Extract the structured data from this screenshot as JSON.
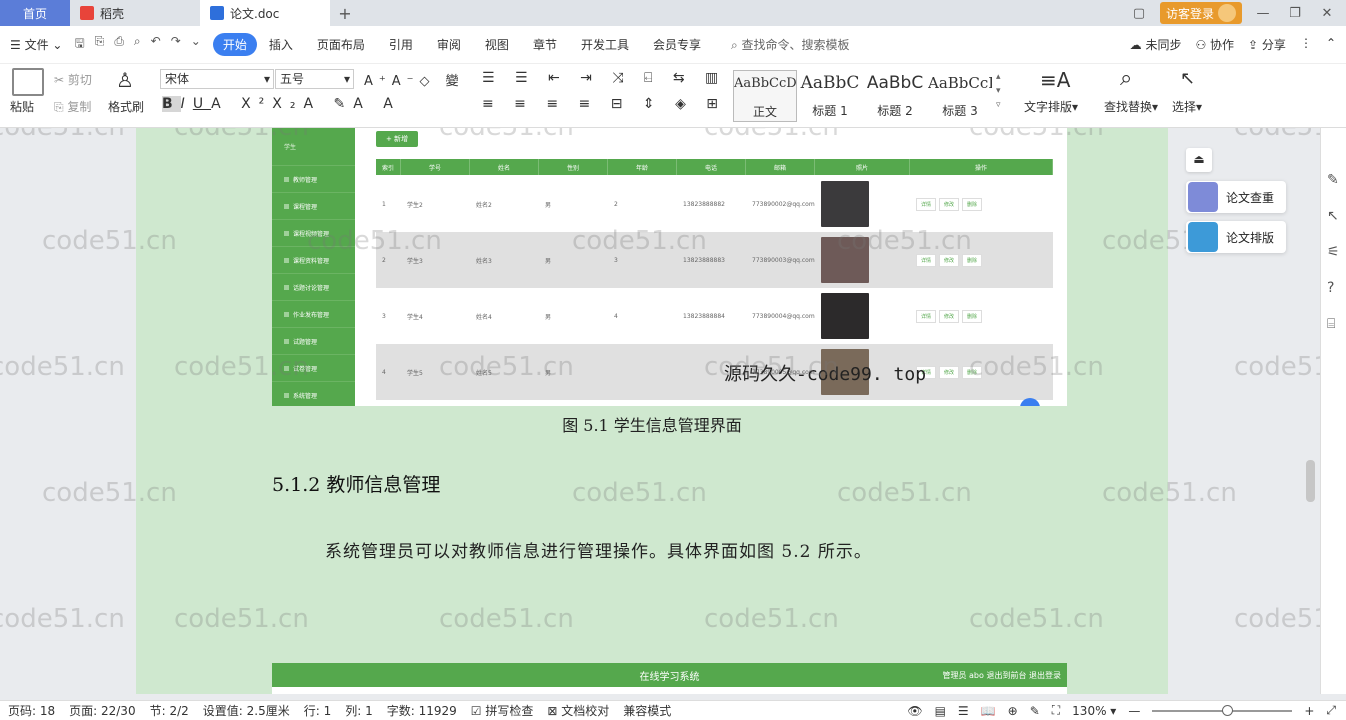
{
  "tabs": {
    "home": "首页",
    "daoke": "稻壳",
    "doc": "论文.doc",
    "add": "+",
    "login": "访客登录"
  },
  "menu": {
    "file": "文件",
    "items": [
      "开始",
      "插入",
      "页面布局",
      "引用",
      "审阅",
      "视图",
      "章节",
      "开发工具",
      "会员专享"
    ],
    "search": "查找命令、搜索模板",
    "right": [
      "未同步",
      "协作",
      "分享"
    ]
  },
  "ribbon": {
    "paste": "粘贴",
    "cut": "剪切",
    "copy": "复制",
    "format_painter": "格式刷",
    "font": "宋体",
    "size": "五号",
    "styles": [
      {
        "sample": "AaBbCcDd",
        "label": "正文"
      },
      {
        "sample": "AaBbC",
        "label": "标题 1"
      },
      {
        "sample": "AaBbC",
        "label": "标题 2"
      },
      {
        "sample": "AaBbCcI",
        "label": "标题 3"
      }
    ],
    "text_layout": "文字排版",
    "find_replace": "查找替换",
    "select": "选择"
  },
  "doc": {
    "fig1": {
      "add_btn": "+ 新增",
      "sidebar": [
        "学生",
        "教师管理",
        "课程管理",
        "课程视频管理",
        "课程资料管理",
        "话题讨论管理",
        "作业发布管理",
        "试题管理",
        "试卷管理",
        "系统管理"
      ],
      "headers": [
        "索引",
        "学号",
        "姓名",
        "性别",
        "年龄",
        "电话",
        "邮箱",
        "照片",
        "操作"
      ],
      "rows": [
        {
          "idx": "1",
          "no": "学生2",
          "name": "姓名2",
          "sex": "男",
          "age": "2",
          "tel": "13823888882",
          "mail": "773890002@qq.com"
        },
        {
          "idx": "2",
          "no": "学生3",
          "name": "姓名3",
          "sex": "男",
          "age": "3",
          "tel": "13823888883",
          "mail": "773890003@qq.com"
        },
        {
          "idx": "3",
          "no": "学生4",
          "name": "姓名4",
          "sex": "男",
          "age": "4",
          "tel": "13823888884",
          "mail": "773890004@qq.com"
        },
        {
          "idx": "4",
          "no": "学生5",
          "name": "姓名5",
          "sex": "男",
          "age": "",
          "tel": "",
          "mail": "773890005@qq.com"
        }
      ],
      "ops": [
        "详情",
        "修改",
        "删除"
      ],
      "overlay": "源码久久-code99. top"
    },
    "caption": "图 5.1  学生信息管理界面",
    "heading": "5.1.2  教师信息管理",
    "para": "系统管理员可以对教师信息进行管理操作。具体界面如图 5.2 所示。",
    "fig2": {
      "title": "在线学习系统",
      "right": "管理员 abo    退出到前台    退出登录"
    }
  },
  "float": {
    "check": "论文查重",
    "layout": "论文排版"
  },
  "watermark": "code51.cn",
  "status": {
    "page_no": "页码: 18",
    "pages": "页面: 22/30",
    "section": "节: 2/2",
    "setting": "设置值: 2.5厘米",
    "row": "行: 1",
    "col": "列: 1",
    "words": "字数: 11929",
    "spell": "拼写检查",
    "proof": "文档校对",
    "compat": "兼容模式",
    "zoom": "130%"
  }
}
